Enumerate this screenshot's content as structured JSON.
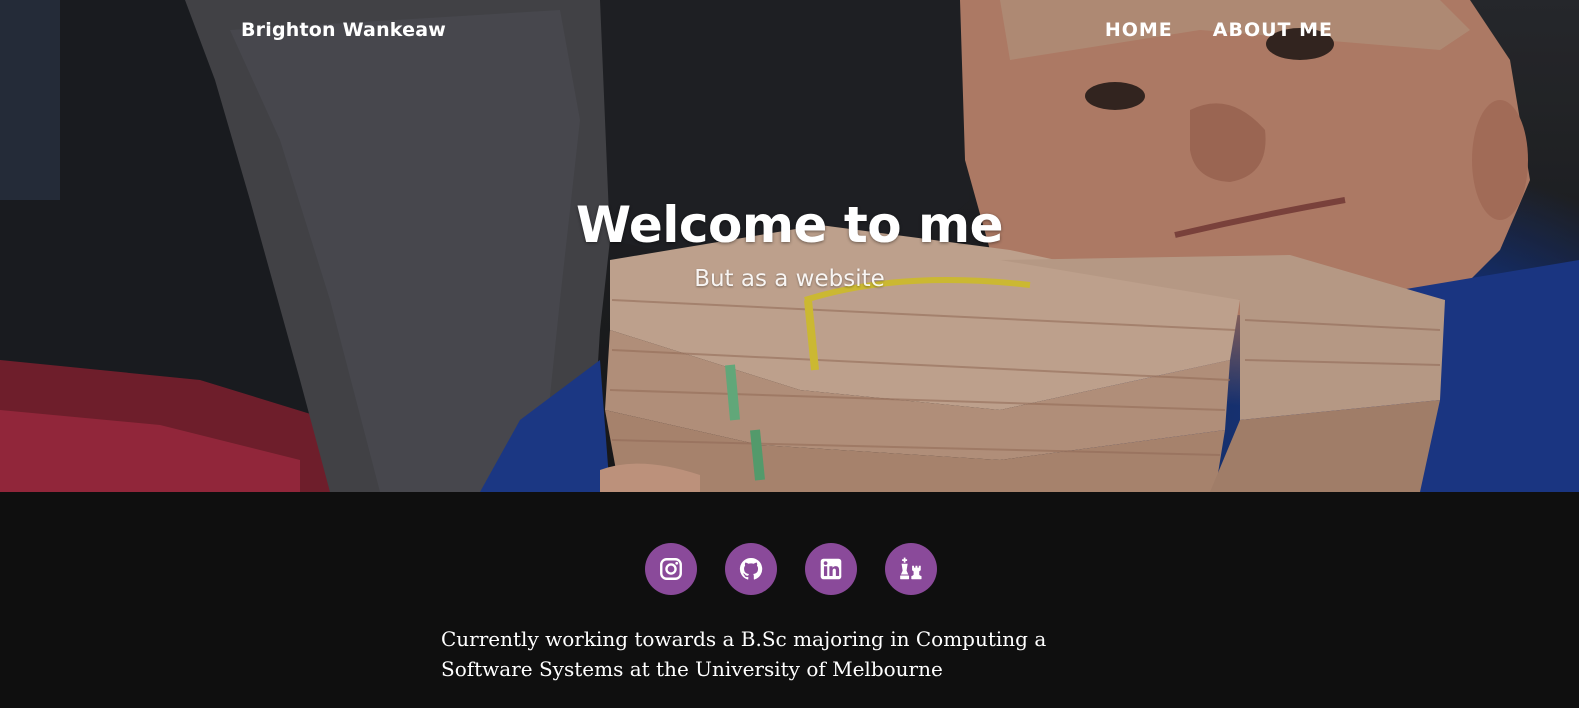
{
  "header": {
    "brand": "Brighton Wankeaw",
    "nav": [
      {
        "label": "HOME"
      },
      {
        "label": "ABOUT ME"
      }
    ]
  },
  "hero": {
    "title": "Welcome to me",
    "subtitle": "But as a website"
  },
  "socials": [
    {
      "icon": "instagram-icon"
    },
    {
      "icon": "github-icon"
    },
    {
      "icon": "linkedin-icon"
    },
    {
      "icon": "chess-icon"
    }
  ],
  "bio": {
    "text": "Currently working towards a B.Sc majoring in Computing a Software Systems at the University of Melbourne"
  },
  "colors": {
    "background": "#0f0f0f",
    "social_button": "#8a4a9a",
    "text": "#ffffff"
  }
}
